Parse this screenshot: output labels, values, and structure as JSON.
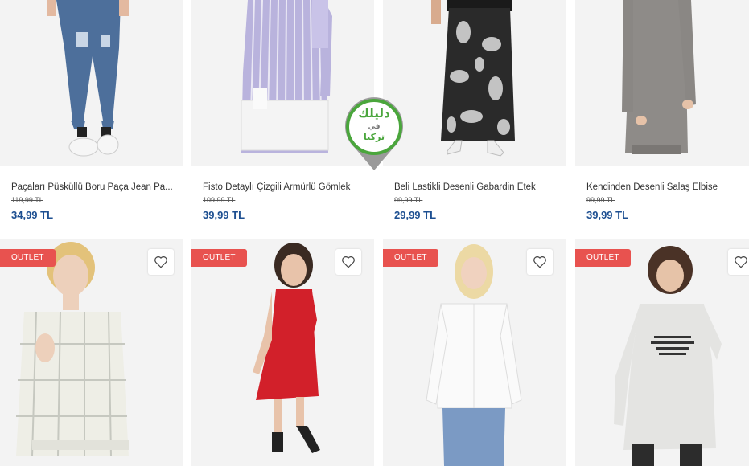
{
  "row1": [
    {
      "name": "Paçaları Püsküllü Boru Paça Jean Pa...",
      "old_price": "119,99 TL",
      "new_price": "34,99 TL"
    },
    {
      "name": "Fisto Detaylı Çizgili Armürlü Gömlek",
      "old_price": "109,99 TL",
      "new_price": "39,99 TL"
    },
    {
      "name": "Beli Lastikli Desenli Gabardin Etek",
      "old_price": "99,99 TL",
      "new_price": "29,99 TL"
    },
    {
      "name": "Kendinden Desenli Salaş Elbise",
      "old_price": "99,99 TL",
      "new_price": "39,99 TL"
    }
  ],
  "row2": [
    {
      "badge": "OUTLET"
    },
    {
      "badge": "OUTLET"
    },
    {
      "badge": "OUTLET"
    },
    {
      "badge": "OUTLET"
    }
  ],
  "watermark": {
    "line1": "دليلك",
    "line2": "في",
    "line3": "تركيا",
    "accent": "#4aa63c"
  },
  "colors": {
    "price": "#1d4f91",
    "badge": "#e8524f"
  }
}
